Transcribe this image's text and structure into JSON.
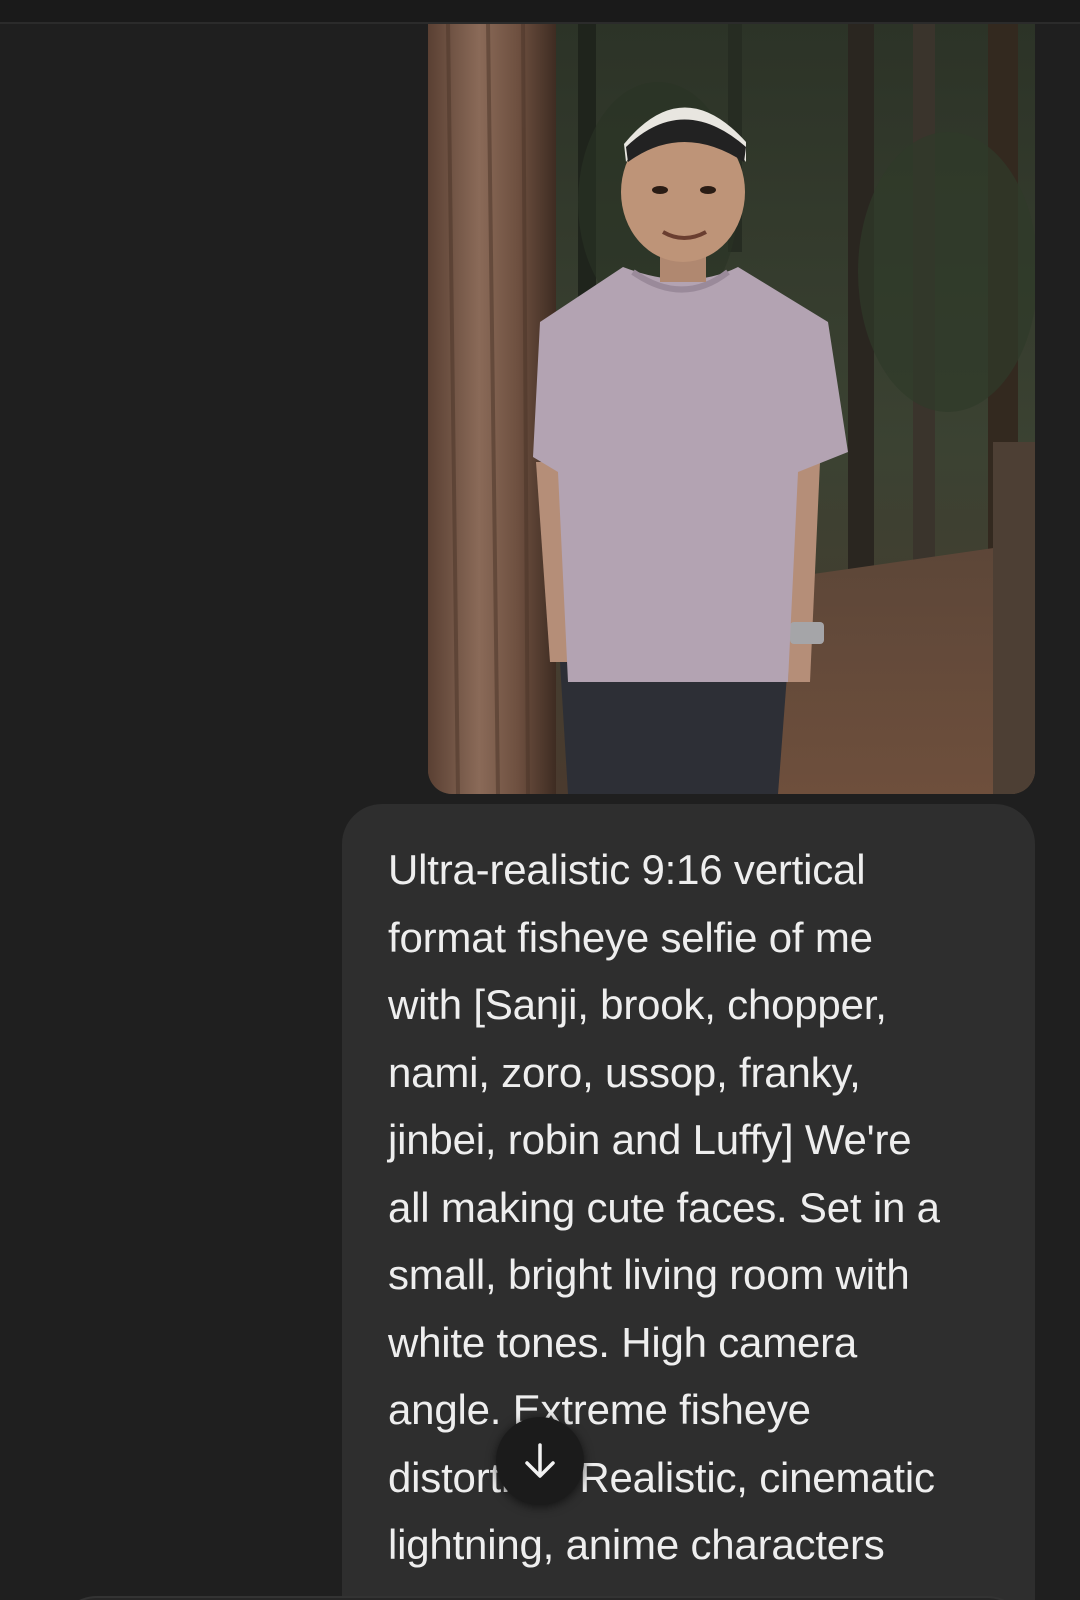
{
  "attachment": {
    "type": "image",
    "description_icon": "photo-attachment"
  },
  "message": {
    "text": "Ultra-realistic 9:16 vertical\nformat fisheye selfie of me\nwith [Sanji, brook, chopper,\nnami, zoro, ussop, franky,\njinbei, robin and Luffy] We're\nall making cute faces. Set in a\nsmall, bright living room with\nwhite tones. High camera\nangle. Extreme fisheye\ndistortion. Realistic, cinematic\nlightning, anime characters"
  },
  "scroll_button": {
    "icon": "arrow-down-icon"
  },
  "colors": {
    "background": "#1f1f1f",
    "bubble": "#2e2e2e",
    "text": "#eeeeee"
  }
}
